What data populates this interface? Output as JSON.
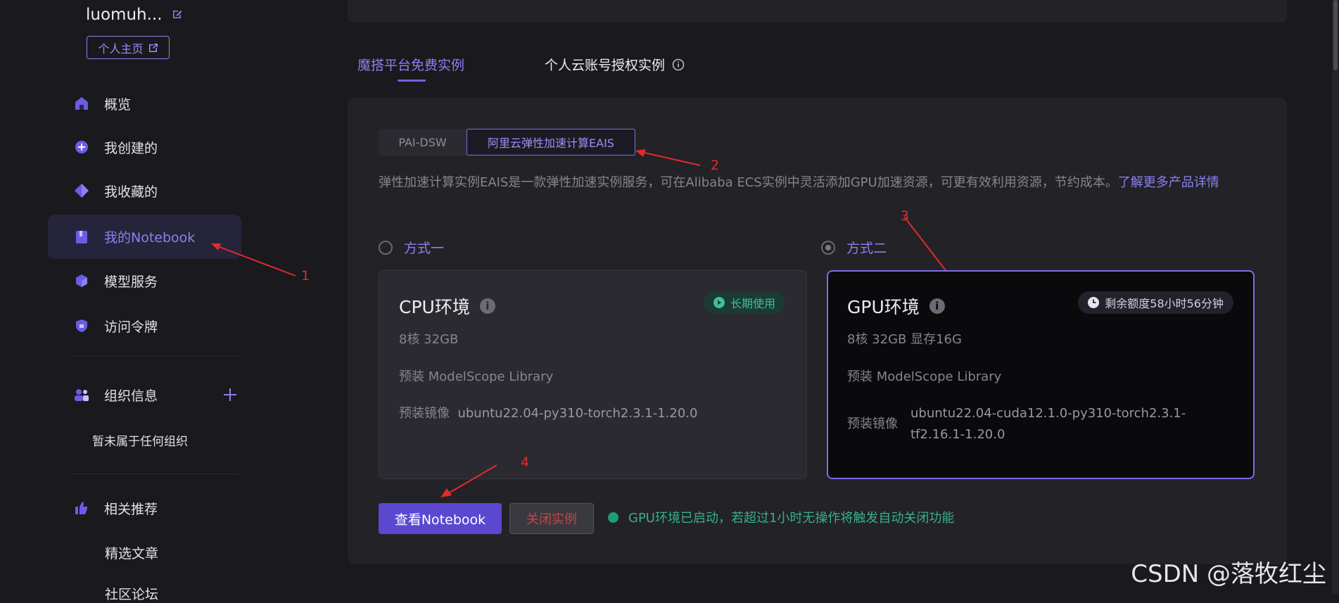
{
  "sidebar": {
    "username": "luomuh...",
    "profile_label": "个人主页",
    "nav": [
      {
        "label": "概览",
        "icon": "home-icon"
      },
      {
        "label": "我创建的",
        "icon": "create-icon"
      },
      {
        "label": "我收藏的",
        "icon": "favorite-icon"
      },
      {
        "label": "我的Notebook",
        "icon": "notebook-icon",
        "active": true
      },
      {
        "label": "模型服务",
        "icon": "cube-icon"
      },
      {
        "label": "访问令牌",
        "icon": "shield-icon"
      }
    ],
    "org_label": "组织信息",
    "org_empty": "暂未属于任何组织",
    "recommend_label": "相关推荐",
    "recommend_items": [
      "精选文章",
      "社区论坛"
    ]
  },
  "tabs": [
    "魔搭平台免费实例",
    "个人云账号授权实例"
  ],
  "segments": [
    "PAI-DSW",
    "阿里云弹性加速计算EAIS"
  ],
  "description": "弹性加速计算实例EAIS是一款弹性加速实例服务，可在Alibaba ECS实例中灵活添加GPU加速资源，可更有效利用资源，节约成本。",
  "description_link": "了解更多产品详情",
  "option1": {
    "radio_label": "方式一",
    "title": "CPU环境",
    "badge": "长期使用",
    "spec": "8核 32GB",
    "preinstall": "预装 ModelScope Library",
    "image_label": "预装镜像",
    "image_value": "ubuntu22.04-py310-torch2.3.1-1.20.0"
  },
  "option2": {
    "radio_label": "方式二",
    "title": "GPU环境",
    "badge": "剩余额度58小时56分钟",
    "spec": "8核 32GB 显存16G",
    "preinstall": "预装 ModelScope Library",
    "image_label": "预装镜像",
    "image_value_line1": "ubuntu22.04-cuda12.1.0-py310-torch2.3.1-",
    "image_value_line2": "tf2.16.1-1.20.0"
  },
  "buttons": {
    "view": "查看Notebook",
    "close": "关闭实例"
  },
  "status": "GPU环境已启动，若超过1小时无操作将触发自动关闭功能",
  "annotations": [
    "1",
    "2",
    "3",
    "4"
  ],
  "watermark": "CSDN @落牧红尘",
  "colors": {
    "accent": "#7a6fe8",
    "status_green": "#37b08c",
    "annotation_red": "#e02b2b"
  }
}
